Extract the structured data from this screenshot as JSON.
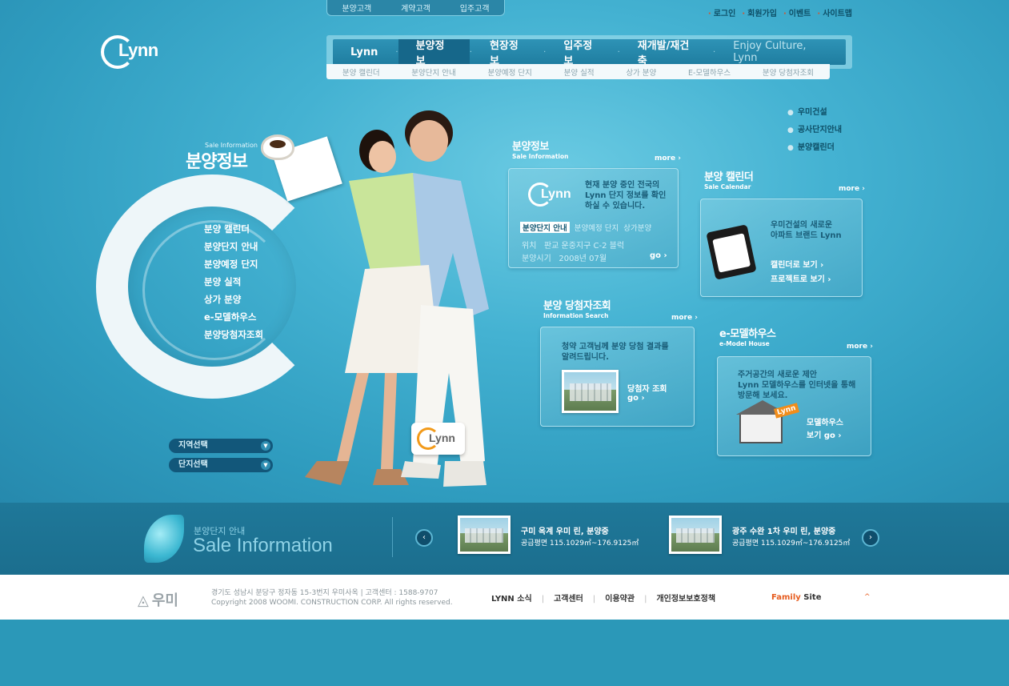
{
  "mini_tabs": [
    "분양고객",
    "계약고객",
    "입주고객"
  ],
  "util_links": [
    "로그인",
    "회원가입",
    "이벤트",
    "사이트맵"
  ],
  "logo": "Lynn",
  "main_nav": {
    "items": [
      "Lynn",
      "분양정보",
      "현장정보",
      "입주정보",
      "재개발/재건축"
    ],
    "brand": "Enjoy Culture, Lynn"
  },
  "sub_nav": [
    "분양 캘린더",
    "분양단지 안내",
    "분양예정 단지",
    "분양 실적",
    "상가 분양",
    "E-모델하우스",
    "분양 당첨자조회"
  ],
  "side_links": [
    "우미건설",
    "공사단지안내",
    "분양캘린더"
  ],
  "hero": {
    "small": "Sale Information",
    "title": "분양정보",
    "menu": [
      "분양 캘린더",
      "분양단지 안내",
      "분양예정 단지",
      "분양 실적",
      "상가 분양",
      "e-모델하우스",
      "분양당첨자조회"
    ]
  },
  "selects": [
    "지역선택",
    "단지선택"
  ],
  "floor_logo": "Lynn",
  "sale_info": {
    "title": "분양정보",
    "sub": "Sale Information",
    "more": "more ›",
    "logo": "Lynn",
    "text_line1": "현재 분양 중인 전국의",
    "text_line2": "Lynn 단지 정보를 확인",
    "text_line3": "하실 수 있습니다.",
    "tabs": [
      "분양단지 안내",
      "분양예정 단지",
      "상가분양"
    ],
    "row1_label": "위치",
    "row1_value": "판교 운중지구 C-2 블럭",
    "row2_label": "분양시기",
    "row2_value": "2008년 07월",
    "go": "go ›"
  },
  "calendar": {
    "title": "분양 캘린더",
    "sub": "Sale Calendar",
    "more": "more ›",
    "text_line1": "우미건설의 새로운",
    "text_line2": "아파트 브랜드 Lynn",
    "link1": "캘린더로 보기 ›",
    "link2": "프로젝트로 보기 ›"
  },
  "winner": {
    "title": "분양 당첨자조회",
    "sub": "Information Search",
    "more": "more ›",
    "text_line1": "청약 고객님께 분양 당첨 결과를",
    "text_line2": "알려드립니다.",
    "link": "당첨자 조회",
    "go": "go ›"
  },
  "model_house": {
    "title": "e-모델하우스",
    "sub": "e-Model House",
    "more": "more ›",
    "text_line1": "주거공간의 새로운 제안",
    "text_line2": "Lynn 모델하우스를 인터넷을 통해",
    "text_line3": "방문해 보세요.",
    "tag": "Lynn",
    "link1": "모델하우스",
    "link2": "보기 go ›"
  },
  "band": {
    "small": "분양단지 안내",
    "big": "Sale Information",
    "prev": "‹",
    "next": "›",
    "items": [
      {
        "title": "구미 옥계 우미 린, 분양중",
        "sub": "공급평면 115.1029㎡~176.9125㎡"
      },
      {
        "title": "광주 수완 1차 우미 린, 분양중",
        "sub": "공급평면 115.1029㎡~176.9125㎡"
      }
    ]
  },
  "footer": {
    "logo": "우미",
    "address": "경기도 성남시 분당구 정자동 15-3번지 우미사옥 | 고객센터 : 1588-9707",
    "copyright": "Copyright 2008 WOOMI. CONSTRUCTION CORP. All rights reserved.",
    "links": [
      "LYNN 소식",
      "고객센터",
      "이용약관",
      "개인정보보호정책"
    ],
    "family_accent": "Family",
    "family_rest": " Site",
    "caret": "^"
  }
}
